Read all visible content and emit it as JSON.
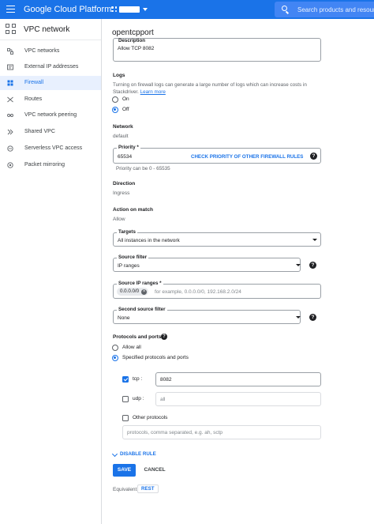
{
  "header": {
    "brand": "Google Cloud Platform",
    "search_placeholder": "Search products and resources"
  },
  "sidebar": {
    "title": "VPC network",
    "items": [
      {
        "label": "VPC networks",
        "icon": "vpc-networks-icon"
      },
      {
        "label": "External IP addresses",
        "icon": "external-ip-icon"
      },
      {
        "label": "Firewall",
        "icon": "firewall-icon",
        "active": true
      },
      {
        "label": "Routes",
        "icon": "routes-icon"
      },
      {
        "label": "VPC network peering",
        "icon": "peering-icon"
      },
      {
        "label": "Shared VPC",
        "icon": "shared-vpc-icon"
      },
      {
        "label": "Serverless VPC access",
        "icon": "serverless-icon"
      },
      {
        "label": "Packet mirroring",
        "icon": "packet-mirroring-icon"
      }
    ]
  },
  "main": {
    "title": "opentcpport",
    "description": {
      "label": "Description",
      "value": "Allow TCP 8082"
    },
    "logs": {
      "title": "Logs",
      "help": "Turning on firewall logs can generate a large number of logs which can increase costs in Stackdriver.",
      "learn_more": "Learn more",
      "on_label": "On",
      "off_label": "Off",
      "selected": "Off"
    },
    "network": {
      "title": "Network",
      "value": "default"
    },
    "priority": {
      "label": "Priority *",
      "value": "65534",
      "check_link": "CHECK PRIORITY OF OTHER FIREWALL RULES",
      "hint": "Priority can be 0 - 65535"
    },
    "direction": {
      "title": "Direction",
      "value": "Ingress"
    },
    "action": {
      "title": "Action on match",
      "value": "Allow"
    },
    "targets": {
      "label": "Targets",
      "value": "All instances in the network"
    },
    "source_filter": {
      "label": "Source filter",
      "value": "IP ranges"
    },
    "source_ip_ranges": {
      "label": "Source IP ranges *",
      "chip": "0.0.0.0/0",
      "placeholder": "for example, 0.0.0.0/0, 192.168.2.0/24"
    },
    "second_source_filter": {
      "label": "Second source filter",
      "value": "None"
    },
    "protocols": {
      "title": "Protocols and ports",
      "allow_all": "Allow all",
      "specified": "Specified protocols and ports",
      "tcp": {
        "label": "tcp :",
        "value": "8082",
        "checked": true
      },
      "udp": {
        "label": "udp :",
        "placeholder": "all",
        "checked": false
      },
      "other": {
        "label": "Other protocols",
        "placeholder": "protocols, comma separated, e.g. ah, sctp",
        "checked": false
      }
    },
    "disable_rule": "DISABLE RULE",
    "save": "SAVE",
    "cancel": "CANCEL",
    "equivalent_label": "Equivalent:",
    "rest": "REST"
  },
  "colors": {
    "brand_blue": "#1a73e8",
    "active_nav_bg": "#e8f0fe"
  }
}
